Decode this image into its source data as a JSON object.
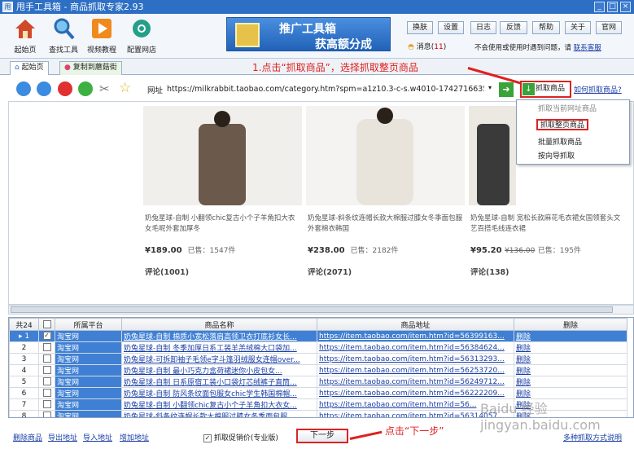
{
  "app": {
    "title": "甩手工具箱 - 商品抓取专家2.93",
    "icon_text": "甩"
  },
  "window_buttons": [
    "_",
    "□",
    "×"
  ],
  "toolbar": {
    "items": [
      {
        "label": "起始页",
        "icon": "home-icon"
      },
      {
        "label": "查找工具",
        "icon": "search-icon"
      },
      {
        "label": "视频教程",
        "icon": "play-icon"
      },
      {
        "label": "配置网店",
        "icon": "gear-icon"
      }
    ],
    "banner": {
      "line1": "推广工具箱",
      "line2": "获高额分成"
    },
    "small_buttons": [
      "换肤",
      "设置",
      "日志",
      "反馈",
      "帮助",
      "关于",
      "官网"
    ],
    "message_label": "消息(",
    "message_count": "11",
    "message_close": ")",
    "notice_text": "不会使用或使用时遇到问题，请",
    "notice_link": "联系客服"
  },
  "tabs": [
    {
      "label": "起始页"
    },
    {
      "label": "复制到蘑菇街"
    }
  ],
  "annotation_top": "1.点击“抓取商品”，选择抓取整页商品",
  "annotation_bottom": "点击“下一步”",
  "navbar": {
    "address_label": "网址",
    "url": "https://milkrabbit.taobao.com/category.htm?spm=a1z10.3-c-s.w4010-1742716635",
    "grab_button": "抓取商品",
    "help_link": "如何抓取商品?"
  },
  "grab_menu": {
    "items": [
      "抓取当前网址商品",
      "抓取整页商品",
      "批量抓取商品",
      "按向导抓取"
    ],
    "highlighted": "抓取整页商品",
    "disabled": "抓取当前网址商品"
  },
  "products": [
    {
      "title": "奶兔星球-自制 小翻领chic复古小个子羊角扣大衣女毛呢外套加厚冬",
      "price": "¥189.00",
      "sold": "已售：1547件",
      "old_price": "",
      "comments": "评论(1001)",
      "coat_color": "#6b5a4c"
    },
    {
      "title": "奶兔星球-斜条纹连帽长款大棉服过膝女冬季面包服外套棉衣韩国",
      "price": "¥238.00",
      "sold": "已售：2182件",
      "old_price": "",
      "comments": "评论(2071)",
      "coat_color": "#e8e4dc"
    },
    {
      "title": "奶兔星球-自制 宽松长款麻花毛衣裙女国领套头文艺百搭毛线连衣裙",
      "price": "¥95.20",
      "sold": "已售：195件",
      "old_price": "¥136.00",
      "comments": "评论(138)",
      "coat_color": "#3a3a3a"
    }
  ],
  "table": {
    "count_label": "共24",
    "headers": [
      "共24",
      "",
      "所属平台",
      "商品名称",
      "商品地址",
      "删除"
    ],
    "rows": [
      {
        "num": "1",
        "checked": true,
        "platform": "淘宝网",
        "name": "奶兔星球-自制 棉质小宽松落肩高领卫衣打底衫女长...",
        "url": "https://item.taobao.com/item.htm?id=56399163...",
        "del": "删除",
        "selected": true
      },
      {
        "num": "2",
        "checked": false,
        "platform": "淘宝网",
        "name": "奶兔星球-自制 冬季加厚日系工装羊羔绒棉大口袋加...",
        "url": "https://item.taobao.com/item.htm?id=56384624...",
        "del": "删除",
        "selected": false
      },
      {
        "num": "3",
        "checked": false,
        "platform": "淘宝网",
        "name": "奶兔星球-可拆卸袖子毛领e字斗篷羽绒服女连帽over...",
        "url": "https://item.taobao.com/item.htm?id=56313293...",
        "del": "删除",
        "selected": false
      },
      {
        "num": "4",
        "checked": false,
        "platform": "淘宝网",
        "name": "奶兔星球-自制 最小巧克力盒荷裙迷你小皮包女...",
        "url": "https://item.taobao.com/item.htm?id=56253720...",
        "del": "删除",
        "selected": false
      },
      {
        "num": "5",
        "checked": false,
        "platform": "淘宝网",
        "name": "奶兔星球-自制 日系原宿工装小口袋灯芯绒裤子直筒...",
        "url": "https://item.taobao.com/item.htm?id=56249712...",
        "del": "删除",
        "selected": false
      },
      {
        "num": "6",
        "checked": false,
        "platform": "淘宝网",
        "name": "奶兔星球-自制 防风条纹面包服女chic学生韩国棉帽...",
        "url": "https://item.taobao.com/item.htm?id=56222209...",
        "del": "删除",
        "selected": false
      },
      {
        "num": "7",
        "checked": false,
        "platform": "淘宝网",
        "name": "奶兔星球-自制 小翻领chic复古小个子羊角扣大衣女...",
        "url": "https://item.taobao.com/item.htm?id=56...",
        "del": "删除",
        "selected": false
      },
      {
        "num": "8",
        "checked": false,
        "platform": "淘宝网",
        "name": "奶兔星球-斜条纹连帽长款大棉服过膝女冬季面包服...",
        "url": "https://item.taobao.com/item.htm?id=56314057...",
        "del": "删除",
        "selected": false
      }
    ]
  },
  "bottom": {
    "links": [
      "删除商品",
      "导出地址",
      "导入地址",
      "增加地址"
    ],
    "promo_checkbox": "抓取促销价(专业版)",
    "next_button": "下一步",
    "help_link": "多种抓取方式说明"
  },
  "watermark": "Baidu 经验 jingyan.baidu.com",
  "colors": {
    "accent": "#2d6fc4",
    "annotation": "#e02020",
    "selected_row": "#3f80d4",
    "link": "#1a3fa6"
  }
}
